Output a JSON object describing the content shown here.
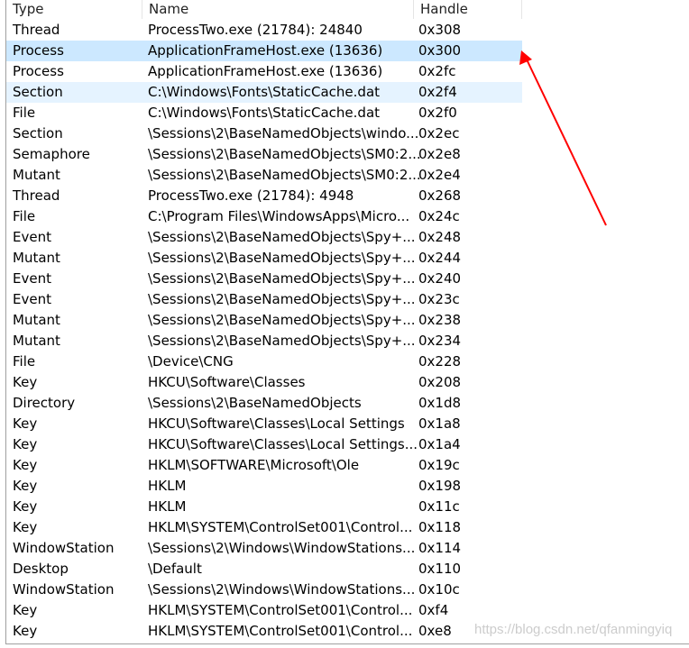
{
  "columns": [
    "Type",
    "Name",
    "Handle"
  ],
  "rows": [
    [
      "Thread",
      "ProcessTwo.exe (21784): 24840",
      "0x308"
    ],
    [
      "Process",
      "ApplicationFrameHost.exe (13636)",
      "0x300"
    ],
    [
      "Process",
      "ApplicationFrameHost.exe (13636)",
      "0x2fc"
    ],
    [
      "Section",
      "C:\\Windows\\Fonts\\StaticCache.dat",
      "0x2f4"
    ],
    [
      "File",
      "C:\\Windows\\Fonts\\StaticCache.dat",
      "0x2f0"
    ],
    [
      "Section",
      "\\Sessions\\2\\BaseNamedObjects\\windo...",
      "0x2ec"
    ],
    [
      "Semaphore",
      "\\Sessions\\2\\BaseNamedObjects\\SM0:2...",
      "0x2e8"
    ],
    [
      "Mutant",
      "\\Sessions\\2\\BaseNamedObjects\\SM0:2...",
      "0x2e4"
    ],
    [
      "Thread",
      "ProcessTwo.exe (21784): 4948",
      "0x268"
    ],
    [
      "File",
      "C:\\Program Files\\WindowsApps\\Micro...",
      "0x24c"
    ],
    [
      "Event",
      "\\Sessions\\2\\BaseNamedObjects\\Spy+...",
      "0x248"
    ],
    [
      "Mutant",
      "\\Sessions\\2\\BaseNamedObjects\\Spy+...",
      "0x244"
    ],
    [
      "Event",
      "\\Sessions\\2\\BaseNamedObjects\\Spy+...",
      "0x240"
    ],
    [
      "Event",
      "\\Sessions\\2\\BaseNamedObjects\\Spy+...",
      "0x23c"
    ],
    [
      "Mutant",
      "\\Sessions\\2\\BaseNamedObjects\\Spy+...",
      "0x238"
    ],
    [
      "Mutant",
      "\\Sessions\\2\\BaseNamedObjects\\Spy+...",
      "0x234"
    ],
    [
      "File",
      "\\Device\\CNG",
      "0x228"
    ],
    [
      "Key",
      "HKCU\\Software\\Classes",
      "0x208"
    ],
    [
      "Directory",
      "\\Sessions\\2\\BaseNamedObjects",
      "0x1d8"
    ],
    [
      "Key",
      "HKCU\\Software\\Classes\\Local Settings",
      "0x1a8"
    ],
    [
      "Key",
      "HKCU\\Software\\Classes\\Local Settings...",
      "0x1a4"
    ],
    [
      "Key",
      "HKLM\\SOFTWARE\\Microsoft\\Ole",
      "0x19c"
    ],
    [
      "Key",
      "HKLM",
      "0x198"
    ],
    [
      "Key",
      "HKLM",
      "0x11c"
    ],
    [
      "Key",
      "HKLM\\SYSTEM\\ControlSet001\\Control...",
      "0x118"
    ],
    [
      "WindowStation",
      "\\Sessions\\2\\Windows\\WindowStations...",
      "0x114"
    ],
    [
      "Desktop",
      "\\Default",
      "0x110"
    ],
    [
      "WindowStation",
      "\\Sessions\\2\\Windows\\WindowStations...",
      "0x10c"
    ],
    [
      "Key",
      "HKLM\\SYSTEM\\ControlSet001\\Control...",
      "0xf4"
    ],
    [
      "Key",
      "HKLM\\SYSTEM\\ControlSet001\\Control...",
      "0xe8"
    ]
  ],
  "selected_row": 1,
  "hover_row": 3,
  "watermark": "https://blog.csdn.net/qfanmingyiq",
  "colors": {
    "selected": "#cce8ff",
    "hover": "#e5f3ff",
    "arrow": "#ff0000"
  }
}
